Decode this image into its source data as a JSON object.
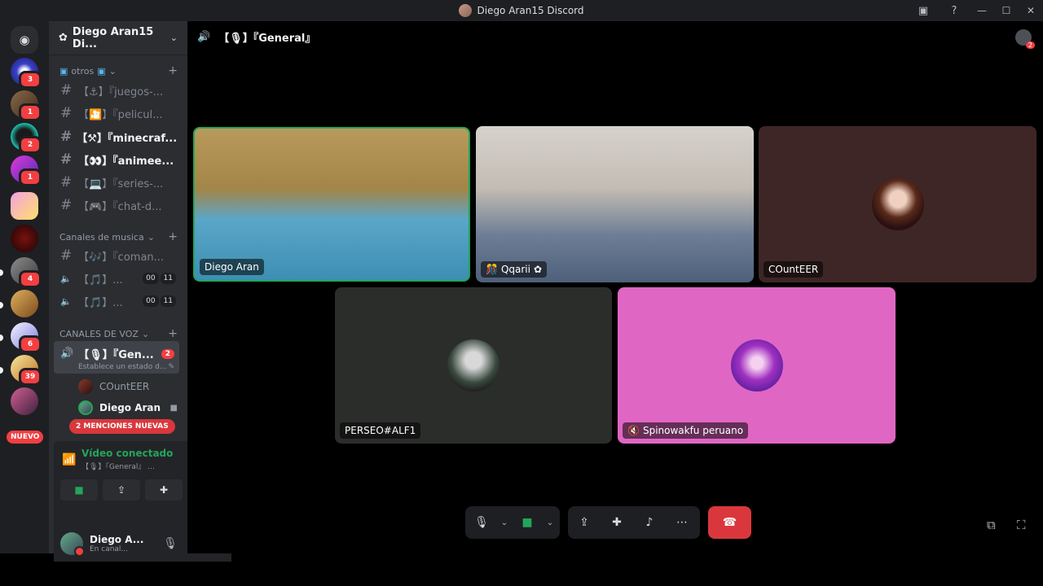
{
  "window": {
    "title": "Diego Aran15 Discord"
  },
  "rail": {
    "badges": [
      "3",
      "1",
      "2",
      "1",
      "4",
      "6",
      "39"
    ],
    "new_label": "NUEVO"
  },
  "guild": {
    "name": "Diego Aran15 Di..."
  },
  "categories": {
    "otros": "otros",
    "musica": "Canales de musica",
    "voz": "CANALES DE VOZ"
  },
  "channels": [
    {
      "name": "【⚓】『juegos-...",
      "unread": false
    },
    {
      "name": "【🎦】『pelicul...",
      "unread": false
    },
    {
      "name": "【⚒】『minecraf...",
      "unread": true
    },
    {
      "name": "【👀】『animee...",
      "unread": true
    },
    {
      "name": "【💻】『series-...",
      "unread": false
    },
    {
      "name": "【🎮】『chat-d...",
      "unread": false
    }
  ],
  "music_channels": [
    {
      "name": "【🎶】『coman...",
      "type": "text"
    },
    {
      "name": "【🎵】...",
      "type": "voice",
      "count_a": "00",
      "count_b": "11"
    },
    {
      "name": "【🎵】...",
      "type": "voice",
      "count_a": "00",
      "count_b": "11"
    }
  ],
  "active_voice": {
    "name": "【🎙】『Gen...",
    "badge": "2",
    "status": "Establece un estado d..."
  },
  "voice_users": [
    {
      "name": "COuntEER"
    },
    {
      "name": "Diego Aran"
    }
  ],
  "mentions": "2 MENCIONES NUEVAS",
  "voice_panel": {
    "status": "Vídeo conectado",
    "channel": "【🎙】『General』 ..."
  },
  "user": {
    "name": "Diego A...",
    "status": "En canal..."
  },
  "call": {
    "channel_title": "【🎙】『General』",
    "header_badge": "2",
    "tiles": [
      {
        "name": "Diego Aran"
      },
      {
        "name": "Qqarii"
      },
      {
        "name": "COuntEER"
      },
      {
        "name": "PERSEO#ALF1"
      },
      {
        "name": "Spinowakfu peruano"
      }
    ]
  },
  "colors": {
    "accent_green": "#23a55a",
    "danger_red": "#da373c",
    "tile_counteer": "#3e2626",
    "tile_perseo": "#2b2d2b",
    "tile_spino": "#e066c4"
  }
}
